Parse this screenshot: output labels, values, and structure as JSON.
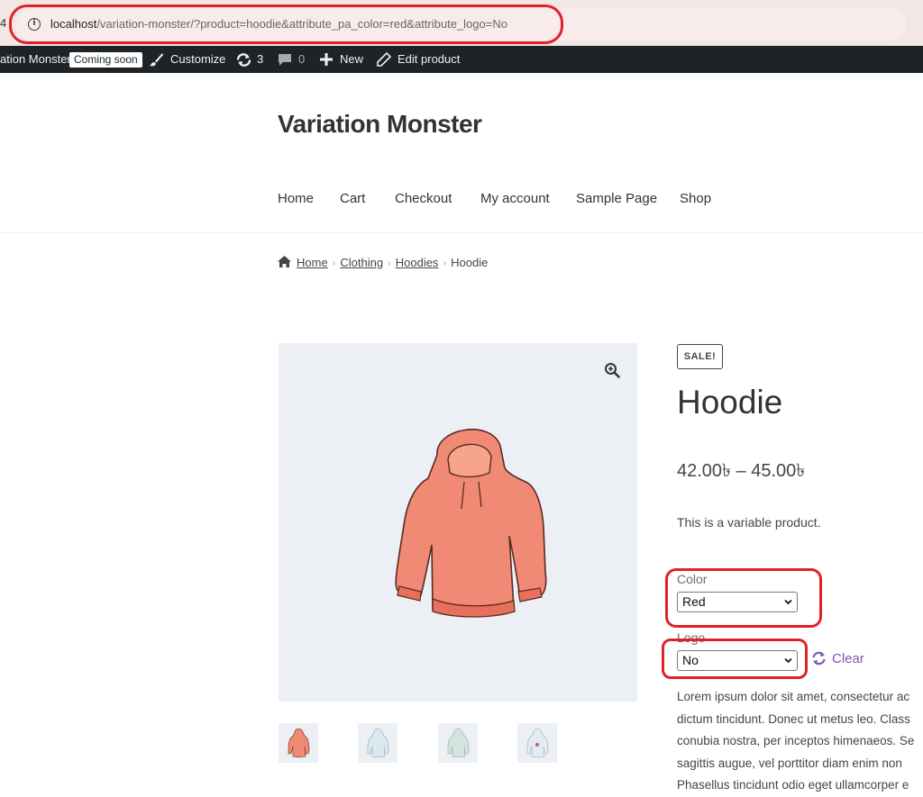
{
  "browser": {
    "edge_glyph": "4",
    "url_host": "localhost",
    "url_path": "/variation-monster/?product=hoodie&attribute_pa_color=red&attribute_logo=No"
  },
  "admin_bar": {
    "site_name": "ation Monster",
    "coming_soon": "Coming soon",
    "customize": "Customize",
    "updates_count": "3",
    "comments_count": "0",
    "new": "New",
    "edit_product": "Edit product",
    "icons": [
      "brush-icon",
      "updates-icon",
      "comment-icon",
      "plus-icon",
      "pencil-icon"
    ]
  },
  "site": {
    "title": "Variation Monster",
    "nav": [
      "Home",
      "Cart",
      "Checkout",
      "My account",
      "Sample Page",
      "Shop"
    ]
  },
  "breadcrumb": {
    "items": [
      "Home",
      "Clothing",
      "Hoodies"
    ],
    "current": "Hoodie",
    "separator": "›"
  },
  "product": {
    "sale_badge": "SALE!",
    "title": "Hoodie",
    "price": "42.00৳  – 45.00৳",
    "short_description": "This is a variable product.",
    "color_label": "Color",
    "color_value": "Red",
    "logo_label": "Logo",
    "logo_value": "No",
    "clear_label": "Clear",
    "description_lines": [
      "Lorem ipsum dolor sit amet, consectetur ac",
      "dictum tincidunt. Donec ut metus leo. Class",
      "conubia nostra, per inceptos himenaeos. Se",
      "sagittis augue, vel porttitor diam enim non",
      "Phasellus tincidunt odio eget ullamcorper e"
    ]
  },
  "colors": {
    "annotation": "#e2202a",
    "accent": "#7f54b3",
    "admin_bar": "#1d2327",
    "hoodie_red": "#f08a74"
  }
}
